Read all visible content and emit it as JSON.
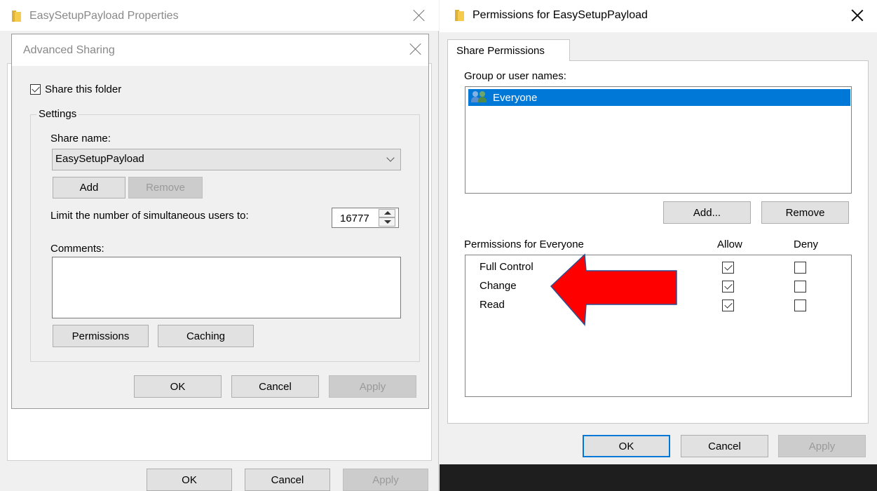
{
  "properties_window": {
    "title": "EasySetupPayload Properties",
    "buttons": {
      "ok": "OK",
      "cancel": "Cancel",
      "apply": "Apply"
    }
  },
  "advanced_sharing": {
    "title": "Advanced Sharing",
    "share_checkbox_label": "Share this folder",
    "share_checked": true,
    "settings_label": "Settings",
    "share_name_label": "Share name:",
    "share_name_value": "EasySetupPayload",
    "add_label": "Add",
    "remove_label": "Remove",
    "limit_label": "Limit the number of simultaneous users to:",
    "limit_value": "16777",
    "comments_label": "Comments:",
    "comments_value": "",
    "permissions_label": "Permissions",
    "caching_label": "Caching",
    "buttons": {
      "ok": "OK",
      "cancel": "Cancel",
      "apply": "Apply"
    }
  },
  "permissions_window": {
    "title": "Permissions for EasySetupPayload",
    "tab_label": "Share Permissions",
    "group_label": "Group or user names:",
    "users": [
      {
        "name": "Everyone",
        "selected": true
      }
    ],
    "add_label": "Add...",
    "remove_label": "Remove",
    "permissions_for_label": "Permissions for Everyone",
    "allow_label": "Allow",
    "deny_label": "Deny",
    "permissions": [
      {
        "name": "Full Control",
        "allow": true,
        "deny": false
      },
      {
        "name": "Change",
        "allow": true,
        "deny": false
      },
      {
        "name": "Read",
        "allow": true,
        "deny": false
      }
    ],
    "buttons": {
      "ok": "OK",
      "cancel": "Cancel",
      "apply": "Apply"
    }
  },
  "colors": {
    "selection": "#0078d7",
    "arrow_fill": "#ff0000",
    "arrow_stroke": "#2f4f8f",
    "taskbar": "#1e1e1e"
  }
}
